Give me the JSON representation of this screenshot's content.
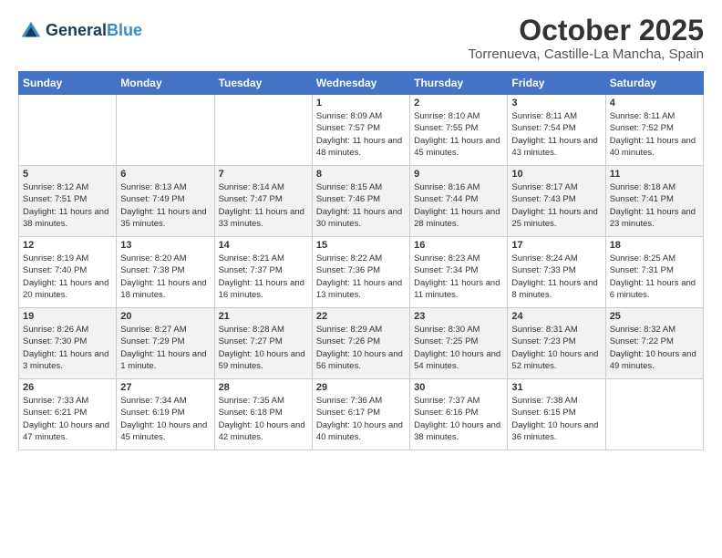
{
  "header": {
    "logo_line1": "General",
    "logo_line2": "Blue",
    "month": "October 2025",
    "location": "Torrenueva, Castille-La Mancha, Spain"
  },
  "days_of_week": [
    "Sunday",
    "Monday",
    "Tuesday",
    "Wednesday",
    "Thursday",
    "Friday",
    "Saturday"
  ],
  "weeks": [
    [
      {
        "day": "",
        "info": ""
      },
      {
        "day": "",
        "info": ""
      },
      {
        "day": "",
        "info": ""
      },
      {
        "day": "1",
        "info": "Sunrise: 8:09 AM\nSunset: 7:57 PM\nDaylight: 11 hours and 48 minutes."
      },
      {
        "day": "2",
        "info": "Sunrise: 8:10 AM\nSunset: 7:55 PM\nDaylight: 11 hours and 45 minutes."
      },
      {
        "day": "3",
        "info": "Sunrise: 8:11 AM\nSunset: 7:54 PM\nDaylight: 11 hours and 43 minutes."
      },
      {
        "day": "4",
        "info": "Sunrise: 8:11 AM\nSunset: 7:52 PM\nDaylight: 11 hours and 40 minutes."
      }
    ],
    [
      {
        "day": "5",
        "info": "Sunrise: 8:12 AM\nSunset: 7:51 PM\nDaylight: 11 hours and 38 minutes."
      },
      {
        "day": "6",
        "info": "Sunrise: 8:13 AM\nSunset: 7:49 PM\nDaylight: 11 hours and 35 minutes."
      },
      {
        "day": "7",
        "info": "Sunrise: 8:14 AM\nSunset: 7:47 PM\nDaylight: 11 hours and 33 minutes."
      },
      {
        "day": "8",
        "info": "Sunrise: 8:15 AM\nSunset: 7:46 PM\nDaylight: 11 hours and 30 minutes."
      },
      {
        "day": "9",
        "info": "Sunrise: 8:16 AM\nSunset: 7:44 PM\nDaylight: 11 hours and 28 minutes."
      },
      {
        "day": "10",
        "info": "Sunrise: 8:17 AM\nSunset: 7:43 PM\nDaylight: 11 hours and 25 minutes."
      },
      {
        "day": "11",
        "info": "Sunrise: 8:18 AM\nSunset: 7:41 PM\nDaylight: 11 hours and 23 minutes."
      }
    ],
    [
      {
        "day": "12",
        "info": "Sunrise: 8:19 AM\nSunset: 7:40 PM\nDaylight: 11 hours and 20 minutes."
      },
      {
        "day": "13",
        "info": "Sunrise: 8:20 AM\nSunset: 7:38 PM\nDaylight: 11 hours and 18 minutes."
      },
      {
        "day": "14",
        "info": "Sunrise: 8:21 AM\nSunset: 7:37 PM\nDaylight: 11 hours and 16 minutes."
      },
      {
        "day": "15",
        "info": "Sunrise: 8:22 AM\nSunset: 7:36 PM\nDaylight: 11 hours and 13 minutes."
      },
      {
        "day": "16",
        "info": "Sunrise: 8:23 AM\nSunset: 7:34 PM\nDaylight: 11 hours and 11 minutes."
      },
      {
        "day": "17",
        "info": "Sunrise: 8:24 AM\nSunset: 7:33 PM\nDaylight: 11 hours and 8 minutes."
      },
      {
        "day": "18",
        "info": "Sunrise: 8:25 AM\nSunset: 7:31 PM\nDaylight: 11 hours and 6 minutes."
      }
    ],
    [
      {
        "day": "19",
        "info": "Sunrise: 8:26 AM\nSunset: 7:30 PM\nDaylight: 11 hours and 3 minutes."
      },
      {
        "day": "20",
        "info": "Sunrise: 8:27 AM\nSunset: 7:29 PM\nDaylight: 11 hours and 1 minute."
      },
      {
        "day": "21",
        "info": "Sunrise: 8:28 AM\nSunset: 7:27 PM\nDaylight: 10 hours and 59 minutes."
      },
      {
        "day": "22",
        "info": "Sunrise: 8:29 AM\nSunset: 7:26 PM\nDaylight: 10 hours and 56 minutes."
      },
      {
        "day": "23",
        "info": "Sunrise: 8:30 AM\nSunset: 7:25 PM\nDaylight: 10 hours and 54 minutes."
      },
      {
        "day": "24",
        "info": "Sunrise: 8:31 AM\nSunset: 7:23 PM\nDaylight: 10 hours and 52 minutes."
      },
      {
        "day": "25",
        "info": "Sunrise: 8:32 AM\nSunset: 7:22 PM\nDaylight: 10 hours and 49 minutes."
      }
    ],
    [
      {
        "day": "26",
        "info": "Sunrise: 7:33 AM\nSunset: 6:21 PM\nDaylight: 10 hours and 47 minutes."
      },
      {
        "day": "27",
        "info": "Sunrise: 7:34 AM\nSunset: 6:19 PM\nDaylight: 10 hours and 45 minutes."
      },
      {
        "day": "28",
        "info": "Sunrise: 7:35 AM\nSunset: 6:18 PM\nDaylight: 10 hours and 42 minutes."
      },
      {
        "day": "29",
        "info": "Sunrise: 7:36 AM\nSunset: 6:17 PM\nDaylight: 10 hours and 40 minutes."
      },
      {
        "day": "30",
        "info": "Sunrise: 7:37 AM\nSunset: 6:16 PM\nDaylight: 10 hours and 38 minutes."
      },
      {
        "day": "31",
        "info": "Sunrise: 7:38 AM\nSunset: 6:15 PM\nDaylight: 10 hours and 36 minutes."
      },
      {
        "day": "",
        "info": ""
      }
    ]
  ]
}
